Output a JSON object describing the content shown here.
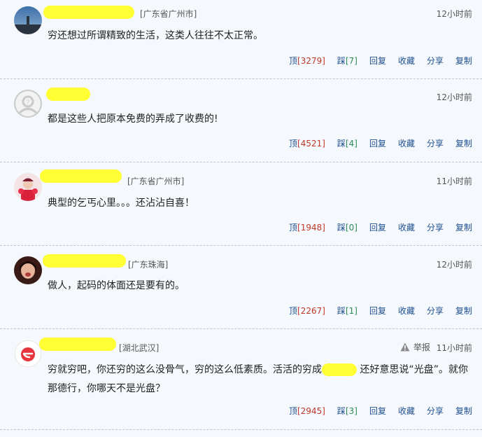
{
  "comments": [
    {
      "location": "[广东省广州市]",
      "time": "12小时前",
      "text": "穷还想过所谓精致的生活，这类人往往不太正常。",
      "up_label": "顶",
      "up_count": "[3279]",
      "down_label": "踩",
      "down_count": "[7]",
      "reply": "回复",
      "fav": "收藏",
      "share": "分享",
      "copy": "复制"
    },
    {
      "location": "",
      "time": "12小时前",
      "text": "都是这些人把原本免费的弄成了收费的!",
      "up_label": "顶",
      "up_count": "[4521]",
      "down_label": "踩",
      "down_count": "[4]",
      "reply": "回复",
      "fav": "收藏",
      "share": "分享",
      "copy": "复制"
    },
    {
      "location": "[广东省广州市]",
      "time": "11小时前",
      "text": "典型的乞丐心里。。。还沾沾自喜！",
      "up_label": "顶",
      "up_count": "[1948]",
      "down_label": "踩",
      "down_count": "[0]",
      "reply": "回复",
      "fav": "收藏",
      "share": "分享",
      "copy": "复制"
    },
    {
      "location": "[广东珠海]",
      "time": "12小时前",
      "text": "做人，起码的体面还是要有的。",
      "up_label": "顶",
      "up_count": "[2267]",
      "down_label": "踩",
      "down_count": "[1]",
      "reply": "回复",
      "fav": "收藏",
      "share": "分享",
      "copy": "复制"
    },
    {
      "location": "[湖北武汉]",
      "time": "11小时前",
      "report": "举报",
      "text_a": "穷就穷吧，你还穷的这么没骨气，穷的这么低素质。活活的穷成",
      "text_b": "还好意思说“光盘”。就你那德行，你哪天不是光盘？",
      "up_label": "顶",
      "up_count": "[2945]",
      "down_label": "踩",
      "down_count": "[3]",
      "reply": "回复",
      "fav": "收藏",
      "share": "分享",
      "copy": "复制"
    }
  ],
  "colors": {
    "link": "#1e4f8f",
    "up": "#c0392b",
    "down": "#2e8b57",
    "mask": "#ffff33"
  }
}
